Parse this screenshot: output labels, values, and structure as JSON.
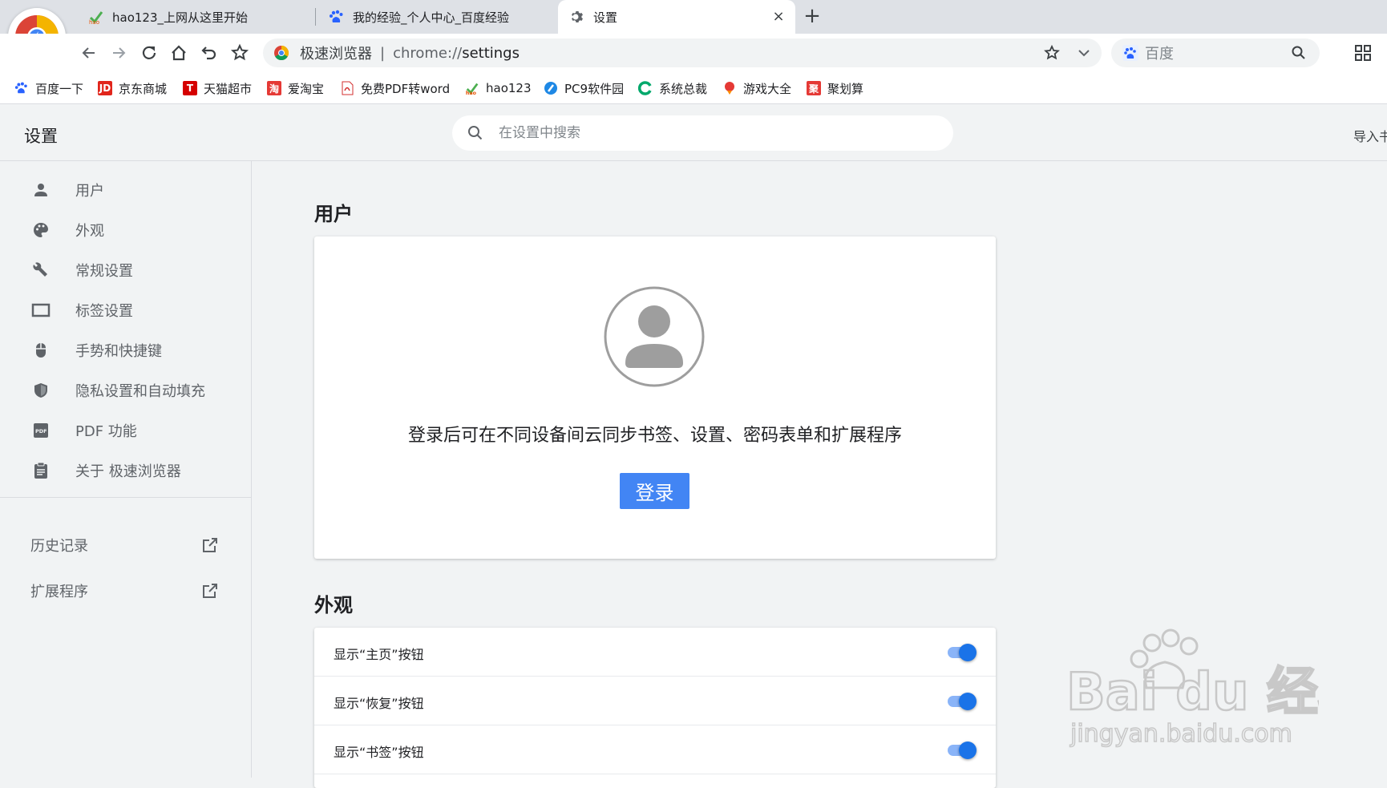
{
  "browser": {
    "tabs": [
      {
        "title": "hao123_上网从这里开始",
        "icon": "hao123-icon"
      },
      {
        "title": "我的经验_个人中心_百度经验",
        "icon": "baidu-paw-icon"
      },
      {
        "title": "设置",
        "icon": "gear-icon",
        "active": true
      }
    ],
    "new_tab_label": "+",
    "close_label": "×"
  },
  "toolbar": {
    "site_label": "极速浏览器",
    "separator": "|",
    "url_scheme": "chrome://",
    "url_path": "settings",
    "search_placeholder": "百度"
  },
  "bookmarks": [
    {
      "label": "百度一下",
      "icon": "baidu-paw-icon"
    },
    {
      "label": "京东商城",
      "icon": "jd-icon",
      "badge": "JD"
    },
    {
      "label": "天猫超市",
      "icon": "tmall-icon",
      "badge": "T"
    },
    {
      "label": "爱淘宝",
      "icon": "taobao-icon",
      "badge": "淘"
    },
    {
      "label": "免费PDF转word",
      "icon": "pdf-icon"
    },
    {
      "label": "hao123",
      "icon": "hao123-icon"
    },
    {
      "label": "PC9软件园",
      "icon": "pc9-icon"
    },
    {
      "label": "系统总裁",
      "icon": "system-icon"
    },
    {
      "label": "游戏大全",
      "icon": "game-icon"
    },
    {
      "label": "聚划算",
      "icon": "juhuasuan-icon",
      "badge": "聚"
    }
  ],
  "settings": {
    "title": "设置",
    "search_placeholder": "在设置中搜索",
    "import_label": "导入书"
  },
  "sidebar": {
    "items": [
      {
        "label": "用户",
        "icon": "person-icon"
      },
      {
        "label": "外观",
        "icon": "palette-icon"
      },
      {
        "label": "常规设置",
        "icon": "wrench-icon"
      },
      {
        "label": "标签设置",
        "icon": "tab-icon"
      },
      {
        "label": "手势和快捷键",
        "icon": "mouse-icon"
      },
      {
        "label": "隐私设置和自动填充",
        "icon": "shield-icon"
      },
      {
        "label": "PDF 功能",
        "icon": "pdf-icon"
      },
      {
        "label": "关于 极速浏览器",
        "icon": "clipboard-icon"
      }
    ],
    "links": [
      {
        "label": "历史记录",
        "icon": "open-external-icon"
      },
      {
        "label": "扩展程序",
        "icon": "open-external-icon"
      }
    ]
  },
  "main": {
    "user_section_title": "用户",
    "sync_text": "登录后可在不同设备间云同步书签、设置、密码表单和扩展程序",
    "login_label": "登录",
    "appearance_section_title": "外观",
    "appearance_rows": [
      {
        "label": "显示“主页”按钮",
        "enabled": true
      },
      {
        "label": "显示“恢复”按钮",
        "enabled": true
      },
      {
        "label": "显示“书签”按钮",
        "enabled": true
      }
    ]
  },
  "watermark": {
    "brand_text": "Bai du 经验",
    "url_text": "jingyan.baidu.com"
  },
  "colors": {
    "accent": "#1a73e8",
    "login_button": "#4285f4",
    "toggle_track": "#8ab4f8"
  }
}
